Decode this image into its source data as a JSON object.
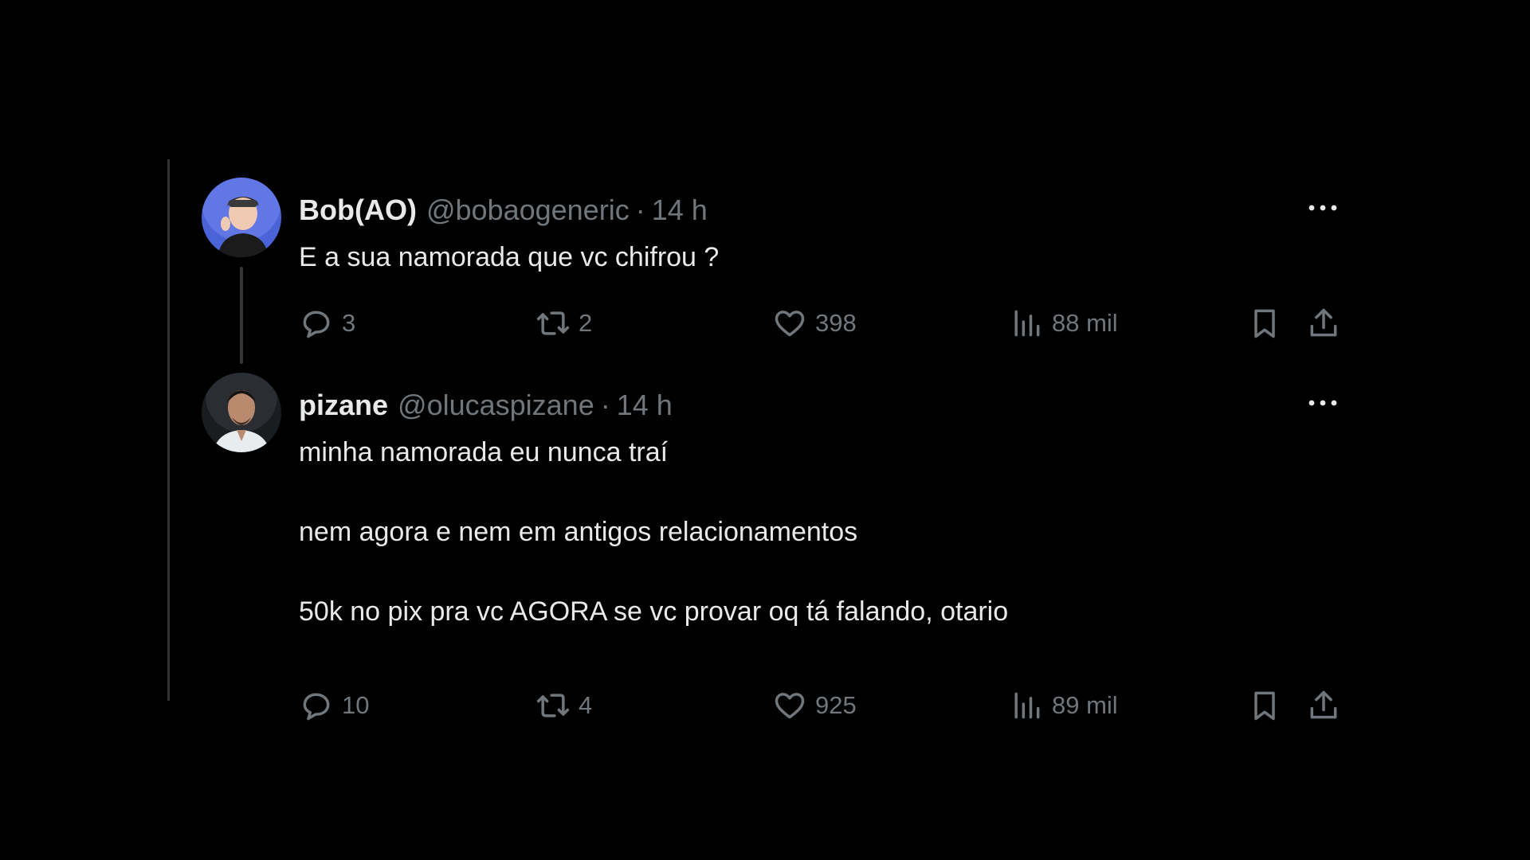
{
  "tweets": [
    {
      "display_name": "Bob(AO)",
      "handle": "@bobaogeneric",
      "separator": "·",
      "time": "14 h",
      "avatar_icon": "avatar-photo",
      "lines": [
        "E a sua namorada que vc chifrou ?"
      ],
      "actions": {
        "replies": "3",
        "retweets": "2",
        "likes": "398",
        "views": "88 mil"
      }
    },
    {
      "display_name": "pizane",
      "handle": "@olucaspizane",
      "separator": "·",
      "time": "14 h",
      "avatar_icon": "avatar-photo",
      "lines": [
        "minha namorada eu nunca traí",
        "nem agora e nem em antigos relacionamentos",
        "50k no pix pra vc AGORA se vc provar oq tá falando, otario"
      ],
      "actions": {
        "replies": "10",
        "retweets": "4",
        "likes": "925",
        "views": "89 mil"
      }
    }
  ],
  "colors": {
    "background": "#000000",
    "text_primary": "#e7e9ea",
    "text_secondary": "#71767b",
    "thread_line": "#333639"
  },
  "icons": [
    "reply-icon",
    "retweet-icon",
    "like-icon",
    "views-icon",
    "bookmark-icon",
    "share-icon",
    "more-icon"
  ]
}
